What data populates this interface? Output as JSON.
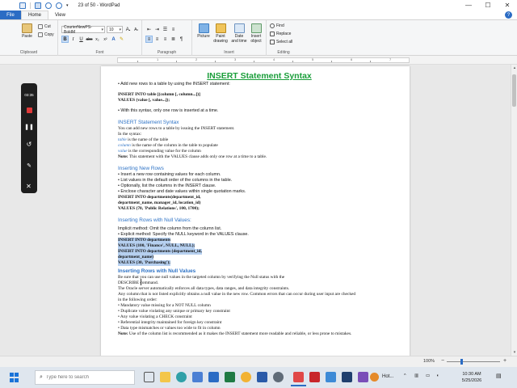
{
  "window": {
    "title": "23 of 50 - WordPad",
    "minimize": "—",
    "maximize": "☐",
    "close": "✕"
  },
  "tabs": {
    "file": "File",
    "home": "Home",
    "view": "View",
    "help": "?"
  },
  "ribbon": {
    "clipboard": {
      "paste": "Paste",
      "cut": "Cut",
      "copy": "Copy",
      "label": "Clipboard"
    },
    "font": {
      "family": "CourierNewPS-BoldM",
      "size": "10",
      "label": "Font"
    },
    "paragraph": {
      "label": "Paragraph"
    },
    "insert": {
      "picture": "Picture",
      "paint": "Paint drawing",
      "datetime": "Date and time",
      "object": "Insert object",
      "label": "Insert"
    },
    "editing": {
      "find": "Find",
      "replace": "Replace",
      "select_all": "Select all",
      "label": "Editing"
    }
  },
  "ruler": {
    "numbers": [
      "1",
      "2",
      "3",
      "4",
      "5",
      "6",
      "7"
    ]
  },
  "document": {
    "title": "INSERT Statement Syntax",
    "l1": "• Add new rows to a table by using the INSERT statement:",
    "l2": "INSERT INTO table [(column [, column...])]",
    "l3": "VALUES (value [, value...]);",
    "l4": "• With this syntax, only one row is inserted at a time.",
    "h2": "INSERT Statement Syntax",
    "l5": "You can add new rows to a table by issuing the INSERT statement.",
    "l6": "In the syntax:",
    "l7a": "table",
    "l7b": " is the name of the table",
    "l8a": "column",
    "l8b": " is the name of the column in the table to populate",
    "l9a": "value",
    "l9b": " is the corresponding value for the column",
    "l10a": "Note:",
    "l10b": " This statement with the VALUES clause adds only one row at a time to a table.",
    "h3": "Inserting New Rows",
    "l11": "• Insert a new row containing values for each column.",
    "l12": "• List values in the default order of the columns in the table.",
    "l13": "• Optionally, list the columns in the INSERT clause.",
    "l14": "• Enclose character and date values within single quotation marks.",
    "l15": "INSERT INTO departments(department_id,",
    "l16": "department_name, manager_id, location_id)",
    "l17": "VALUES (70, 'Public Relations', 100, 1700);",
    "h4": "Inserting Rows with Null Values:",
    "l18": "Implicit method: Omit the column from the column list.",
    "l19": "• Explicit method: Specify the NULL keyword in the VALUES clause.",
    "s1": "INSERT INTO departments",
    "s2": "VALUES (100, 'Finance', NULL, NULL);",
    "s3": "INSERT INTO departments (department_id,",
    "s4": "department_name)",
    "s5": "VALUES (30, 'Purchasing');",
    "h5": "Inserting Rows with Null Values",
    "l20": "Be sure that you can use null values in the targeted column by verifying the Null status with the",
    "l21": "DESCRIBE command.",
    "l22": "The Oracle server automatically enforces all data types, data ranges, and data integrity constraints.",
    "l23": "Any column that is not listed explicitly obtains a null value in the new row. Common errors that can occur during user input are checked",
    "l24": "in the following order:",
    "l25": "• Mandatory value missing for a NOT NULL column",
    "l26": "• Duplicate value violating any unique or primary key constraint",
    "l27": "• Any value violating a CHECK constraint",
    "l28": "• Referential integrity maintained for foreign key constraint",
    "l29": "• Data type mismatches or values too wide to fit in column",
    "l30a": "Note:",
    "l30b": " Use of the column list is recommended as it makes the INSERT statement more readable and reliable, or less prone to mistakes."
  },
  "recorder": {
    "time": "03:35"
  },
  "status": {
    "zoom": "100%",
    "zoom_out": "−",
    "zoom_in": "+"
  },
  "taskbar": {
    "search_placeholder": "Type here to search",
    "weather_label": "Hot...",
    "time": "10:30 AM",
    "date": "5/25/2026"
  }
}
